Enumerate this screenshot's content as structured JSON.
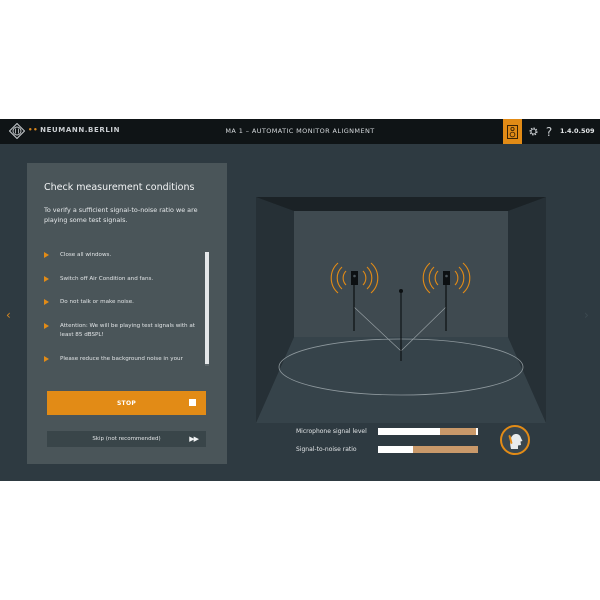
{
  "brand": {
    "name": "NEUMANN.BERLIN",
    "prefix": "••"
  },
  "header": {
    "title": "MA 1 – AUTOMATIC MONITOR ALIGNMENT",
    "version": "1.4.0.509",
    "help_label": "?"
  },
  "panel": {
    "title": "Check measurement conditions",
    "intro": "To verify a sufficient signal-to-noise ratio we are playing some test signals.",
    "checklist": [
      "Close all windows.",
      "Switch off Air Condition and fans.",
      "Do not talk or make noise.",
      "Attention: We will be playing test signals with at least 85 dBSPL!",
      "Please reduce the background noise in your"
    ],
    "stop_label": "STOP",
    "skip_label": "Skip (not recommended)",
    "skip_icon": "▶▶"
  },
  "navigation": {
    "prev_glyph": "‹",
    "next_glyph": "›"
  },
  "meters": {
    "mic_label": "Microphone signal level",
    "snr_label": "Signal-to-noise ratio",
    "mic_level": 0.62,
    "mic_peak": 0.98,
    "snr_level": 0.35,
    "snr_peak": 1.0
  },
  "colors": {
    "accent": "#e28b16",
    "background": "#2e3a41",
    "panel": "#4a5559",
    "topbar": "#0f1416"
  },
  "icons": [
    "neumann-logo-icon",
    "measurement-icon",
    "gear-icon",
    "help-icon",
    "chevron-left-icon",
    "chevron-right-icon",
    "stop-icon",
    "fast-forward-icon",
    "speaker-icon",
    "microphone-icon",
    "listener-head-icon"
  ]
}
